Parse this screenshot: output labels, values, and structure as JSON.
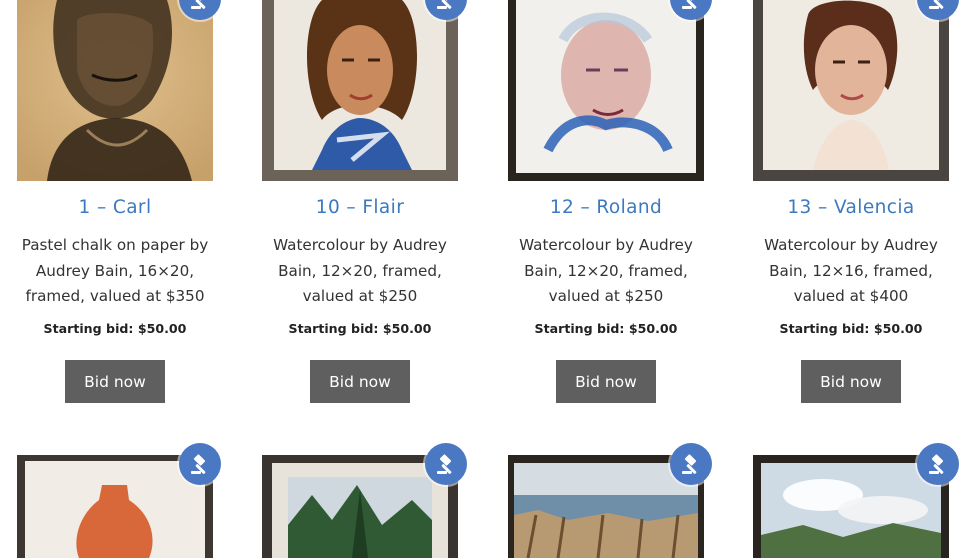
{
  "lots": [
    {
      "title": "1 – Carl",
      "desc_lines": [
        "Pastel chalk on paper by",
        "Audrey Bain, 16×20,",
        "framed, valued at $350"
      ],
      "starting_bid_label": "Starting bid:",
      "starting_bid_value": "$50.00",
      "button": "Bid now"
    },
    {
      "title": "10 – Flair",
      "desc_lines": [
        "Watercolour by  Audrey",
        "Bain, 12×20, framed,",
        "valued at $250"
      ],
      "starting_bid_label": "Starting bid:",
      "starting_bid_value": "$50.00",
      "button": "Bid now"
    },
    {
      "title": "12 – Roland",
      "desc_lines": [
        "Watercolour by Audrey",
        "Bain, 12×20, framed,",
        "valued at $250"
      ],
      "starting_bid_label": "Starting bid:",
      "starting_bid_value": "$50.00",
      "button": "Bid now"
    },
    {
      "title": "13 – Valencia",
      "desc_lines": [
        "Watercolour by Audrey",
        "Bain, 12×16, framed,",
        "valued at $400"
      ],
      "starting_bid_label": "Starting bid:",
      "starting_bid_value": "$50.00",
      "button": "Bid now"
    }
  ],
  "icons": {
    "auction": "gavel-icon"
  },
  "colors": {
    "title": "#3c79bf",
    "button": "#5f5f5f",
    "gavel_badge": "#4b78c2"
  }
}
